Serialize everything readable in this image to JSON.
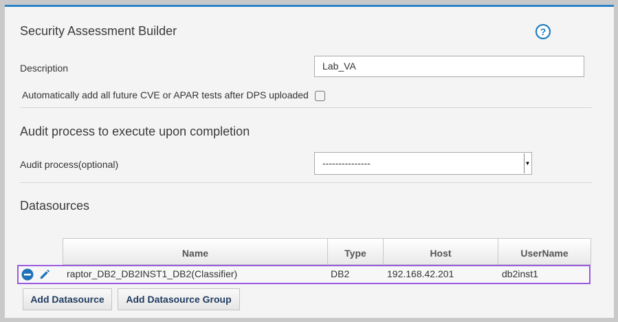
{
  "header": {
    "title": "Security Assessment Builder"
  },
  "form": {
    "description_label": "Description",
    "description_value": "Lab_VA",
    "auto_add_label": "Automatically add all future CVE or APAR tests after DPS uploaded",
    "auto_add_checked": false
  },
  "audit": {
    "section_title": "Audit process to execute upon completion",
    "label": "Audit process(optional)",
    "selected": "---------------"
  },
  "datasources": {
    "section_title": "Datasources",
    "columns": [
      "Name",
      "Type",
      "Host",
      "UserName"
    ],
    "rows": [
      {
        "name": "raptor_DB2_DB2INST1_DB2(Classifier)",
        "type": "DB2",
        "host": "192.168.42.201",
        "username": "db2inst1"
      }
    ],
    "add_button": "Add Datasource",
    "add_group_button": "Add Datasource Group"
  },
  "colors": {
    "accent": "#2a82c8",
    "selection_border": "#9b59e0",
    "button_text": "#1e3a5f"
  },
  "icons": {
    "help": "help-circle-icon",
    "remove": "minus-circle-icon",
    "edit": "pencil-icon"
  }
}
